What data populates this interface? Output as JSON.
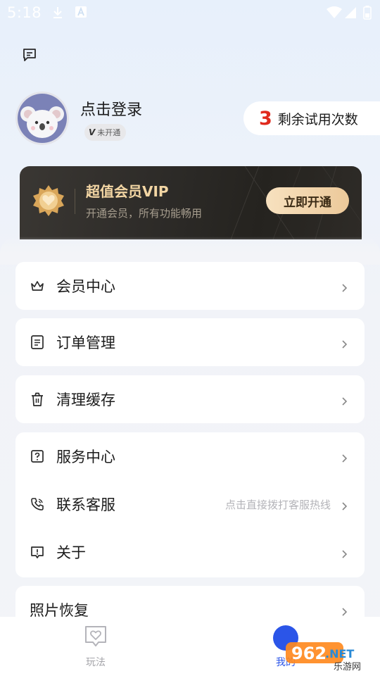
{
  "status_bar": {
    "time": "5:18",
    "left_icons": [
      "download-icon",
      "a-notification-icon"
    ],
    "right_icons": [
      "wifi-icon",
      "signal-icon",
      "battery-icon"
    ]
  },
  "header": {
    "message_icon": "message-icon"
  },
  "profile": {
    "login_text": "点击登录",
    "vip_badge_letter": "V",
    "vip_badge_text": "未开通",
    "trial_count": "3",
    "trial_label": "剩余试用次数"
  },
  "vip_card": {
    "title": "超值会员VIP",
    "subtitle": "开通会员，所有功能畅用",
    "button_label": "立即开通",
    "colors": {
      "title": "#f3d6a4",
      "button_start": "#f7e1bf",
      "button_end": "#ecc99a"
    }
  },
  "menu": {
    "member_center": "会员中心",
    "order_management": "订单管理",
    "clear_cache": "清理缓存",
    "service_center": "服务中心",
    "contact_service": "联系客服",
    "contact_hint": "点击直接拨打客服热线",
    "about": "关于",
    "photo_recovery": "照片恢复"
  },
  "bottom_nav": {
    "play_label": "玩法",
    "mine_label": "我的",
    "active_color": "#2b55e8"
  },
  "watermark": {
    "brand": "962",
    "net": ".NET",
    "sub": "乐游网"
  },
  "colors": {
    "accent_red": "#e02a1d",
    "accent_blue": "#2b55e8"
  }
}
